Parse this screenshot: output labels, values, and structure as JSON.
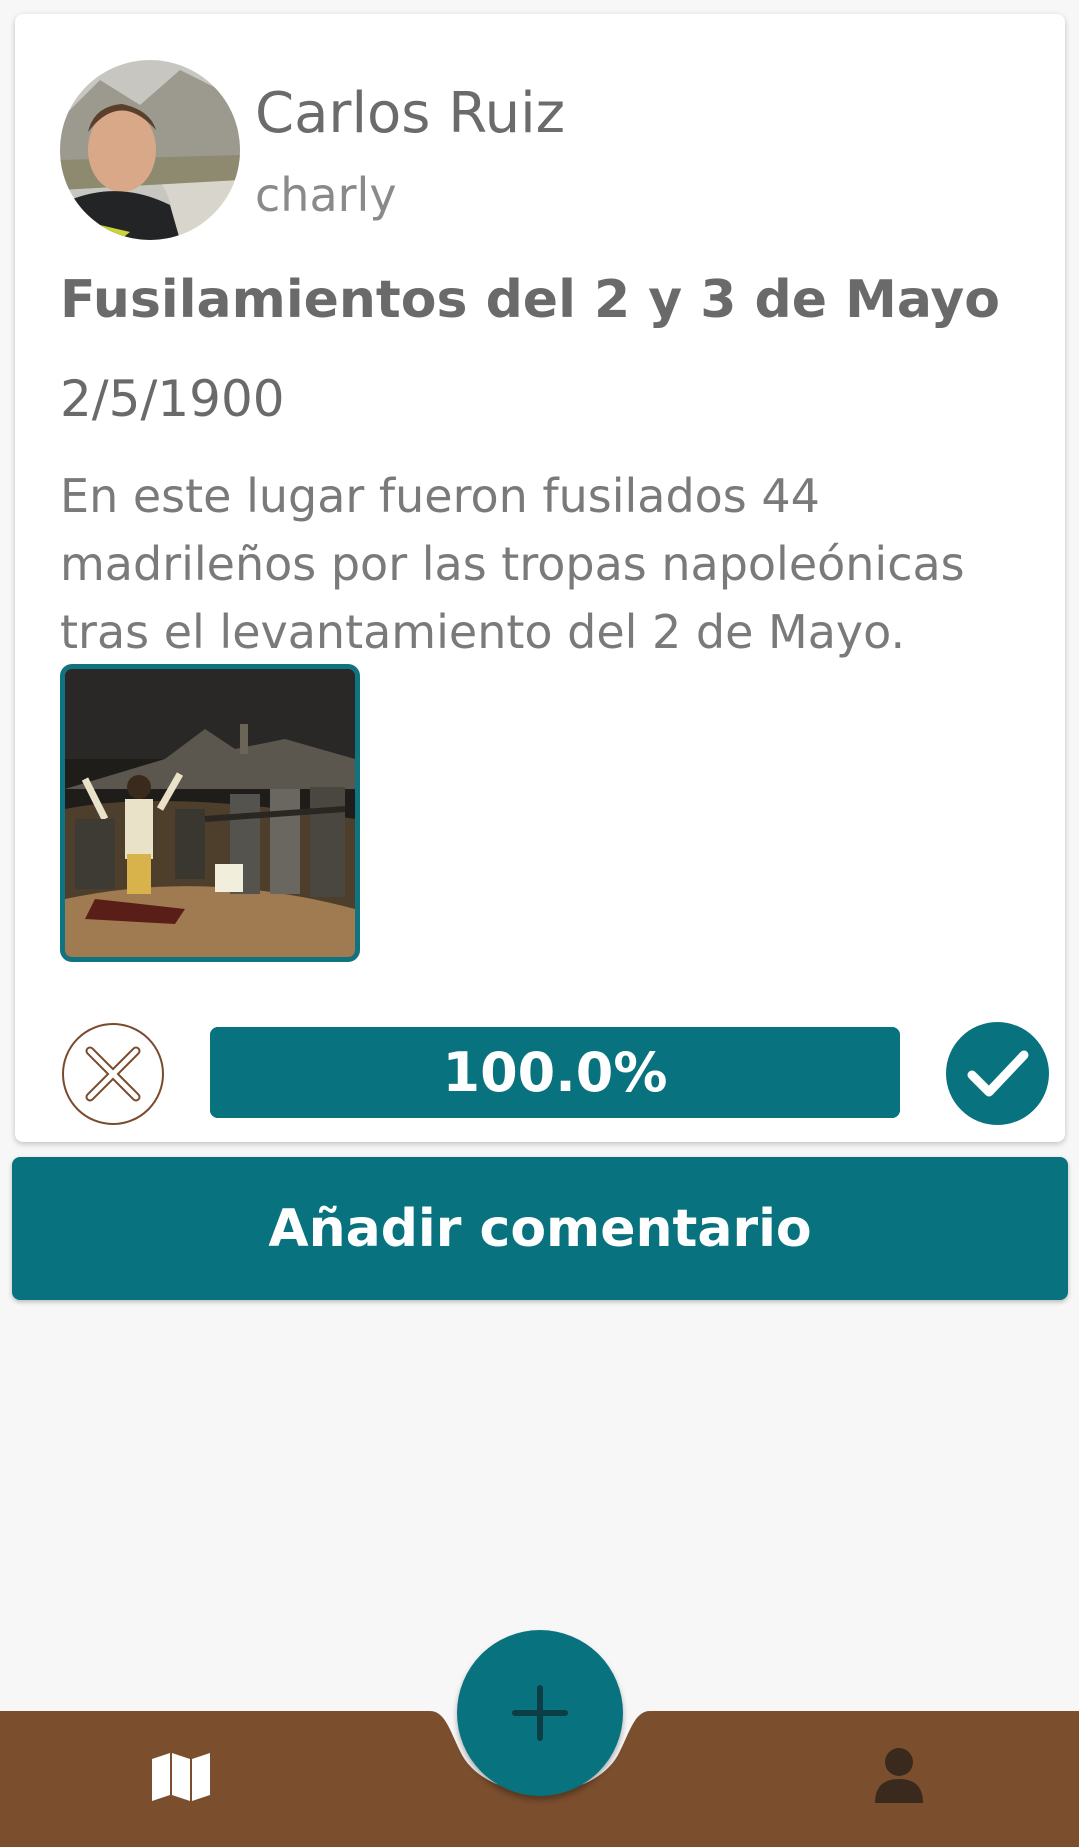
{
  "author": {
    "name": "Carlos Ruiz",
    "handle": "charly"
  },
  "post": {
    "title": "Fusilamientos del 2 y 3 de Mayo",
    "date": "2/5/1900",
    "description": "En este lugar fueron fusilados 44 madrileños por las tropas napoleónicas tras el levantamiento del 2 de Mayo."
  },
  "verification": {
    "progress_label": "100.0%",
    "progress_fraction": 1.0
  },
  "actions": {
    "add_comment_label": "Añadir comentario"
  },
  "nav": {
    "items": [
      {
        "name": "map",
        "icon": "map-icon"
      },
      {
        "name": "add",
        "icon": "plus-icon"
      },
      {
        "name": "profile",
        "icon": "person-icon"
      }
    ]
  },
  "colors": {
    "primary": "#08737f",
    "nav_background": "#7b4e2e",
    "card_background": "#ffffff"
  }
}
